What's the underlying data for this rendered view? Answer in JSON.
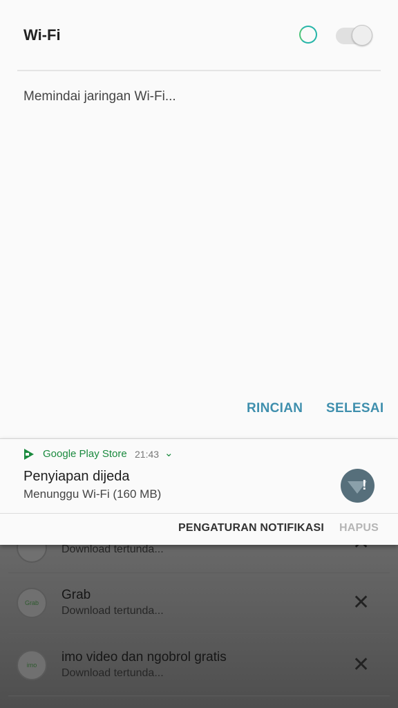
{
  "wifi_panel": {
    "title": "Wi-Fi",
    "status_text": "Memindai jaringan Wi-Fi...",
    "toggle_state": "off",
    "buttons": {
      "details": "RINCIAN",
      "done": "SELESAI"
    }
  },
  "notification": {
    "app_name": "Google Play Store",
    "time": "21:43",
    "title": "Penyiapan dijeda",
    "subtitle": "Menunggu Wi-Fi (160 MB)",
    "actions": {
      "settings": "PENGATURAN NOTIFIKASI",
      "clear": "HAPUS"
    }
  },
  "background_list": {
    "items": [
      {
        "title": "",
        "subtitle": "Download tertunda..."
      },
      {
        "title": "Grab",
        "subtitle": "Download tertunda...",
        "icon_text": "Grab"
      },
      {
        "title": "imo video dan ngobrol gratis",
        "subtitle": "Download tertunda...",
        "icon_text": "imo"
      }
    ],
    "close_glyph": "✕"
  },
  "colors": {
    "accent": "#3f8fad",
    "play_green": "#1a8a3e",
    "disabled": "#b5b5b5"
  }
}
